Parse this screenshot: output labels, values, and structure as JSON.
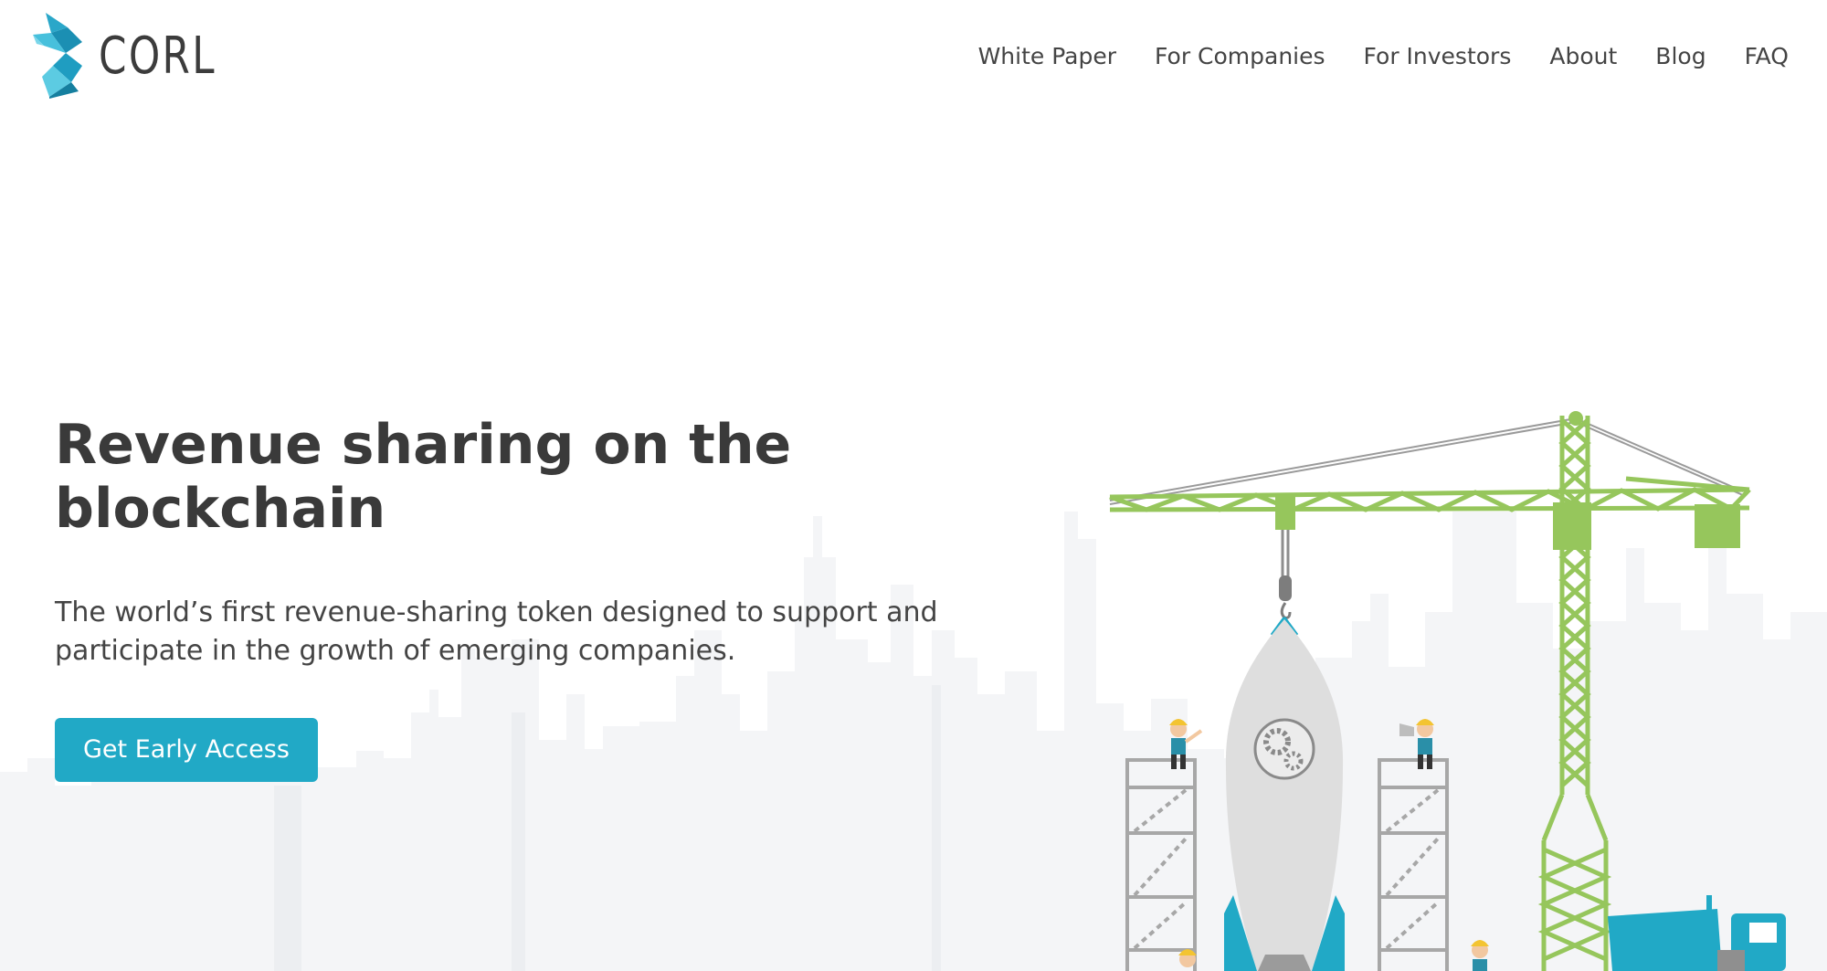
{
  "brand": {
    "name": "CORL",
    "logo_icon": "corl-logo-icon"
  },
  "nav": {
    "items": [
      {
        "label": "White Paper"
      },
      {
        "label": "For Companies"
      },
      {
        "label": "For Investors"
      },
      {
        "label": "About"
      },
      {
        "label": "Blog"
      },
      {
        "label": "FAQ"
      }
    ]
  },
  "hero": {
    "title": "Revenue sharing on the blockchain",
    "subtitle": "The world’s first revenue-sharing token designed to support and participate in the growth of emerging companies.",
    "cta_label": "Get Early Access"
  },
  "colors": {
    "accent": "#21a9c6",
    "crane_green": "#96c65c",
    "text_dark": "#3a3a3a",
    "skyline": "#f3f4f6"
  }
}
